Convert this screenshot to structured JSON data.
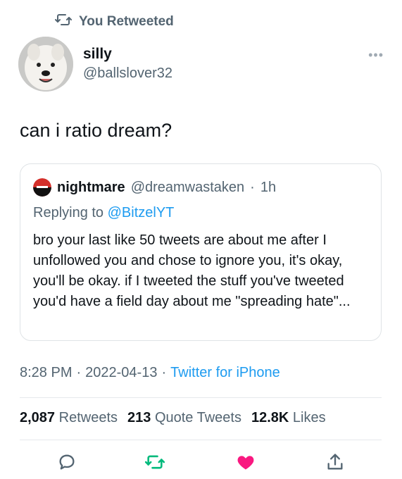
{
  "retweet_banner": {
    "label": "You Retweeted",
    "icon": "retweet-icon"
  },
  "tweet": {
    "display_name": "silly",
    "handle": "@ballslover32",
    "more_icon": "more-icon",
    "text": "can i ratio dream?"
  },
  "quoted_tweet": {
    "display_name": "nightmare",
    "handle": "@dreamwastaken",
    "separator": "·",
    "time": "1h",
    "replying_prefix": "Replying to",
    "replying_mention": "@BitzelYT",
    "text": "bro your last like 50 tweets are about me after I unfollowed you and chose to ignore you, it's okay, you'll be okay. if I tweeted the stuff you've tweeted you'd have a field day about me \"spreading hate\"..."
  },
  "meta": {
    "time": "8:28 PM",
    "sep1": "·",
    "date": "2022-04-13",
    "sep2": "·",
    "source": "Twitter for iPhone"
  },
  "stats": {
    "retweets_count": "2,087",
    "retweets_label": "Retweets",
    "quotes_count": "213",
    "quotes_label": "Quote Tweets",
    "likes_count": "12.8K",
    "likes_label": "Likes"
  },
  "actions": {
    "reply_icon": "reply-icon",
    "retweet_icon": "retweet-icon",
    "like_icon": "heart-icon",
    "share_icon": "share-icon"
  },
  "colors": {
    "accent": "#1d9bf0",
    "retweet_green": "#00ba7c",
    "like_pink": "#f91880",
    "secondary_text": "#536471"
  }
}
